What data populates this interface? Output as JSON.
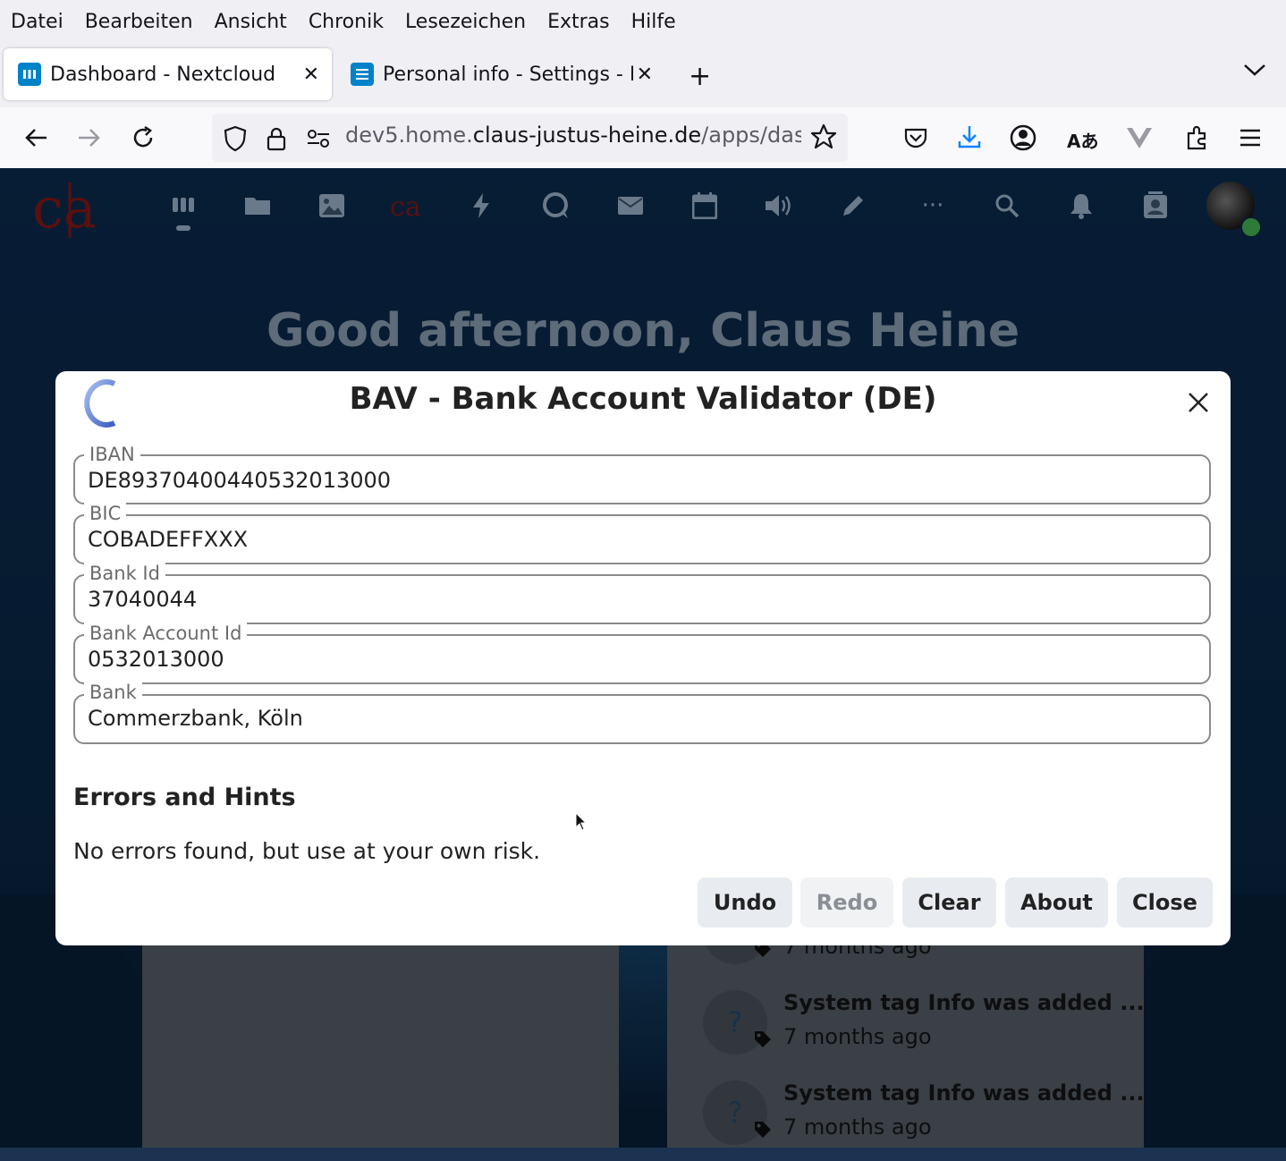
{
  "menubar": [
    "Datei",
    "Bearbeiten",
    "Ansicht",
    "Chronik",
    "Lesezeichen",
    "Extras",
    "Hilfe"
  ],
  "tabs": [
    {
      "title": "Dashboard - Nextcloud",
      "active": true
    },
    {
      "title": "Personal info - Settings - N",
      "active": false
    }
  ],
  "url": {
    "prefix": "dev5.home.",
    "host": "claus-justus-heine.de",
    "path": "/apps/dashbo"
  },
  "greeting": "Good afternoon, Claus Heine",
  "dialog": {
    "title": "BAV - Bank Account Validator (DE)",
    "fields": [
      {
        "label": "IBAN",
        "value": "DE89370400440532013000"
      },
      {
        "label": "BIC",
        "value": "COBADEFFXXX"
      },
      {
        "label": "Bank Id",
        "value": "37040044"
      },
      {
        "label": "Bank Account Id",
        "value": "0532013000"
      },
      {
        "label": "Bank",
        "value": "Commerzbank, Köln"
      }
    ],
    "hints_heading": "Errors and Hints",
    "hints_text": "No errors found, but use at your own risk.",
    "buttons": {
      "undo": "Undo",
      "redo": "Redo",
      "clear": "Clear",
      "about": "About",
      "close": "Close"
    }
  },
  "activity": [
    {
      "title": "",
      "time": "7 months ago"
    },
    {
      "title": "System tag Info was added ...",
      "time": "7 months ago"
    },
    {
      "title": "System tag Info was added ...",
      "time": "7 months ago"
    }
  ],
  "avatar_glyph": "?",
  "colors": {
    "accent": "#0082c9",
    "header_bg": "#0e3561",
    "dialog_bg": "#ffffff"
  }
}
